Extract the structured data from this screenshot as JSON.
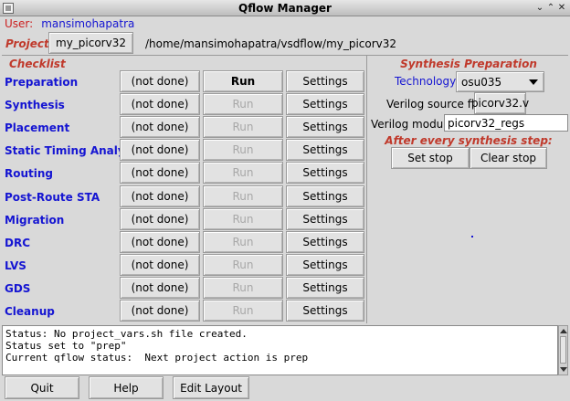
{
  "window": {
    "title": "Qflow Manager",
    "minimize_glyph": "⌄",
    "maximize_glyph": "⌃",
    "close_glyph": "✕"
  },
  "user": {
    "label": "User:",
    "name": "mansimohapatra"
  },
  "project": {
    "label": "Project:",
    "button": "my_picorv32",
    "path": "/home/mansimohapatra/vsdflow/my_picorv32"
  },
  "checklist": {
    "title": "Checklist",
    "steps": [
      {
        "name": "Preparation",
        "status": "(not done)",
        "run": "Run",
        "run_enabled": true,
        "settings": "Settings"
      },
      {
        "name": "Synthesis",
        "status": "(not done)",
        "run": "Run",
        "run_enabled": false,
        "settings": "Settings"
      },
      {
        "name": "Placement",
        "status": "(not done)",
        "run": "Run",
        "run_enabled": false,
        "settings": "Settings"
      },
      {
        "name": "Static Timing Analysis",
        "status": "(not done)",
        "run": "Run",
        "run_enabled": false,
        "settings": "Settings"
      },
      {
        "name": "Routing",
        "status": "(not done)",
        "run": "Run",
        "run_enabled": false,
        "settings": "Settings"
      },
      {
        "name": "Post-Route STA",
        "status": "(not done)",
        "run": "Run",
        "run_enabled": false,
        "settings": "Settings"
      },
      {
        "name": "Migration",
        "status": "(not done)",
        "run": "Run",
        "run_enabled": false,
        "settings": "Settings"
      },
      {
        "name": "DRC",
        "status": "(not done)",
        "run": "Run",
        "run_enabled": false,
        "settings": "Settings"
      },
      {
        "name": "LVS",
        "status": "(not done)",
        "run": "Run",
        "run_enabled": false,
        "settings": "Settings"
      },
      {
        "name": "GDS",
        "status": "(not done)",
        "run": "Run",
        "run_enabled": false,
        "settings": "Settings"
      },
      {
        "name": "Cleanup",
        "status": "(not done)",
        "run": "Run",
        "run_enabled": false,
        "settings": "Settings"
      }
    ]
  },
  "synthesis_prep": {
    "title": "Synthesis Preparation",
    "technology_label": "Technology:",
    "technology_value": "osu035",
    "verilog_source_label": "Verilog source file:",
    "verilog_source_value": "picorv32.v",
    "verilog_module_label": "Verilog module:",
    "verilog_module_value": "picorv32_regs",
    "after_step_label": "After every synthesis step:",
    "set_stop": "Set stop",
    "clear_stop": "Clear stop"
  },
  "status": {
    "lines": [
      "Status: No project_vars.sh file created.",
      "Status set to \"prep\"",
      "Current qflow status:  Next project action is prep"
    ]
  },
  "footer": {
    "quit": "Quit",
    "help": "Help",
    "edit_layout": "Edit Layout"
  },
  "colors": {
    "label_red": "#c0392b",
    "label_blue": "#1515d2",
    "background": "#d9d9d9"
  }
}
